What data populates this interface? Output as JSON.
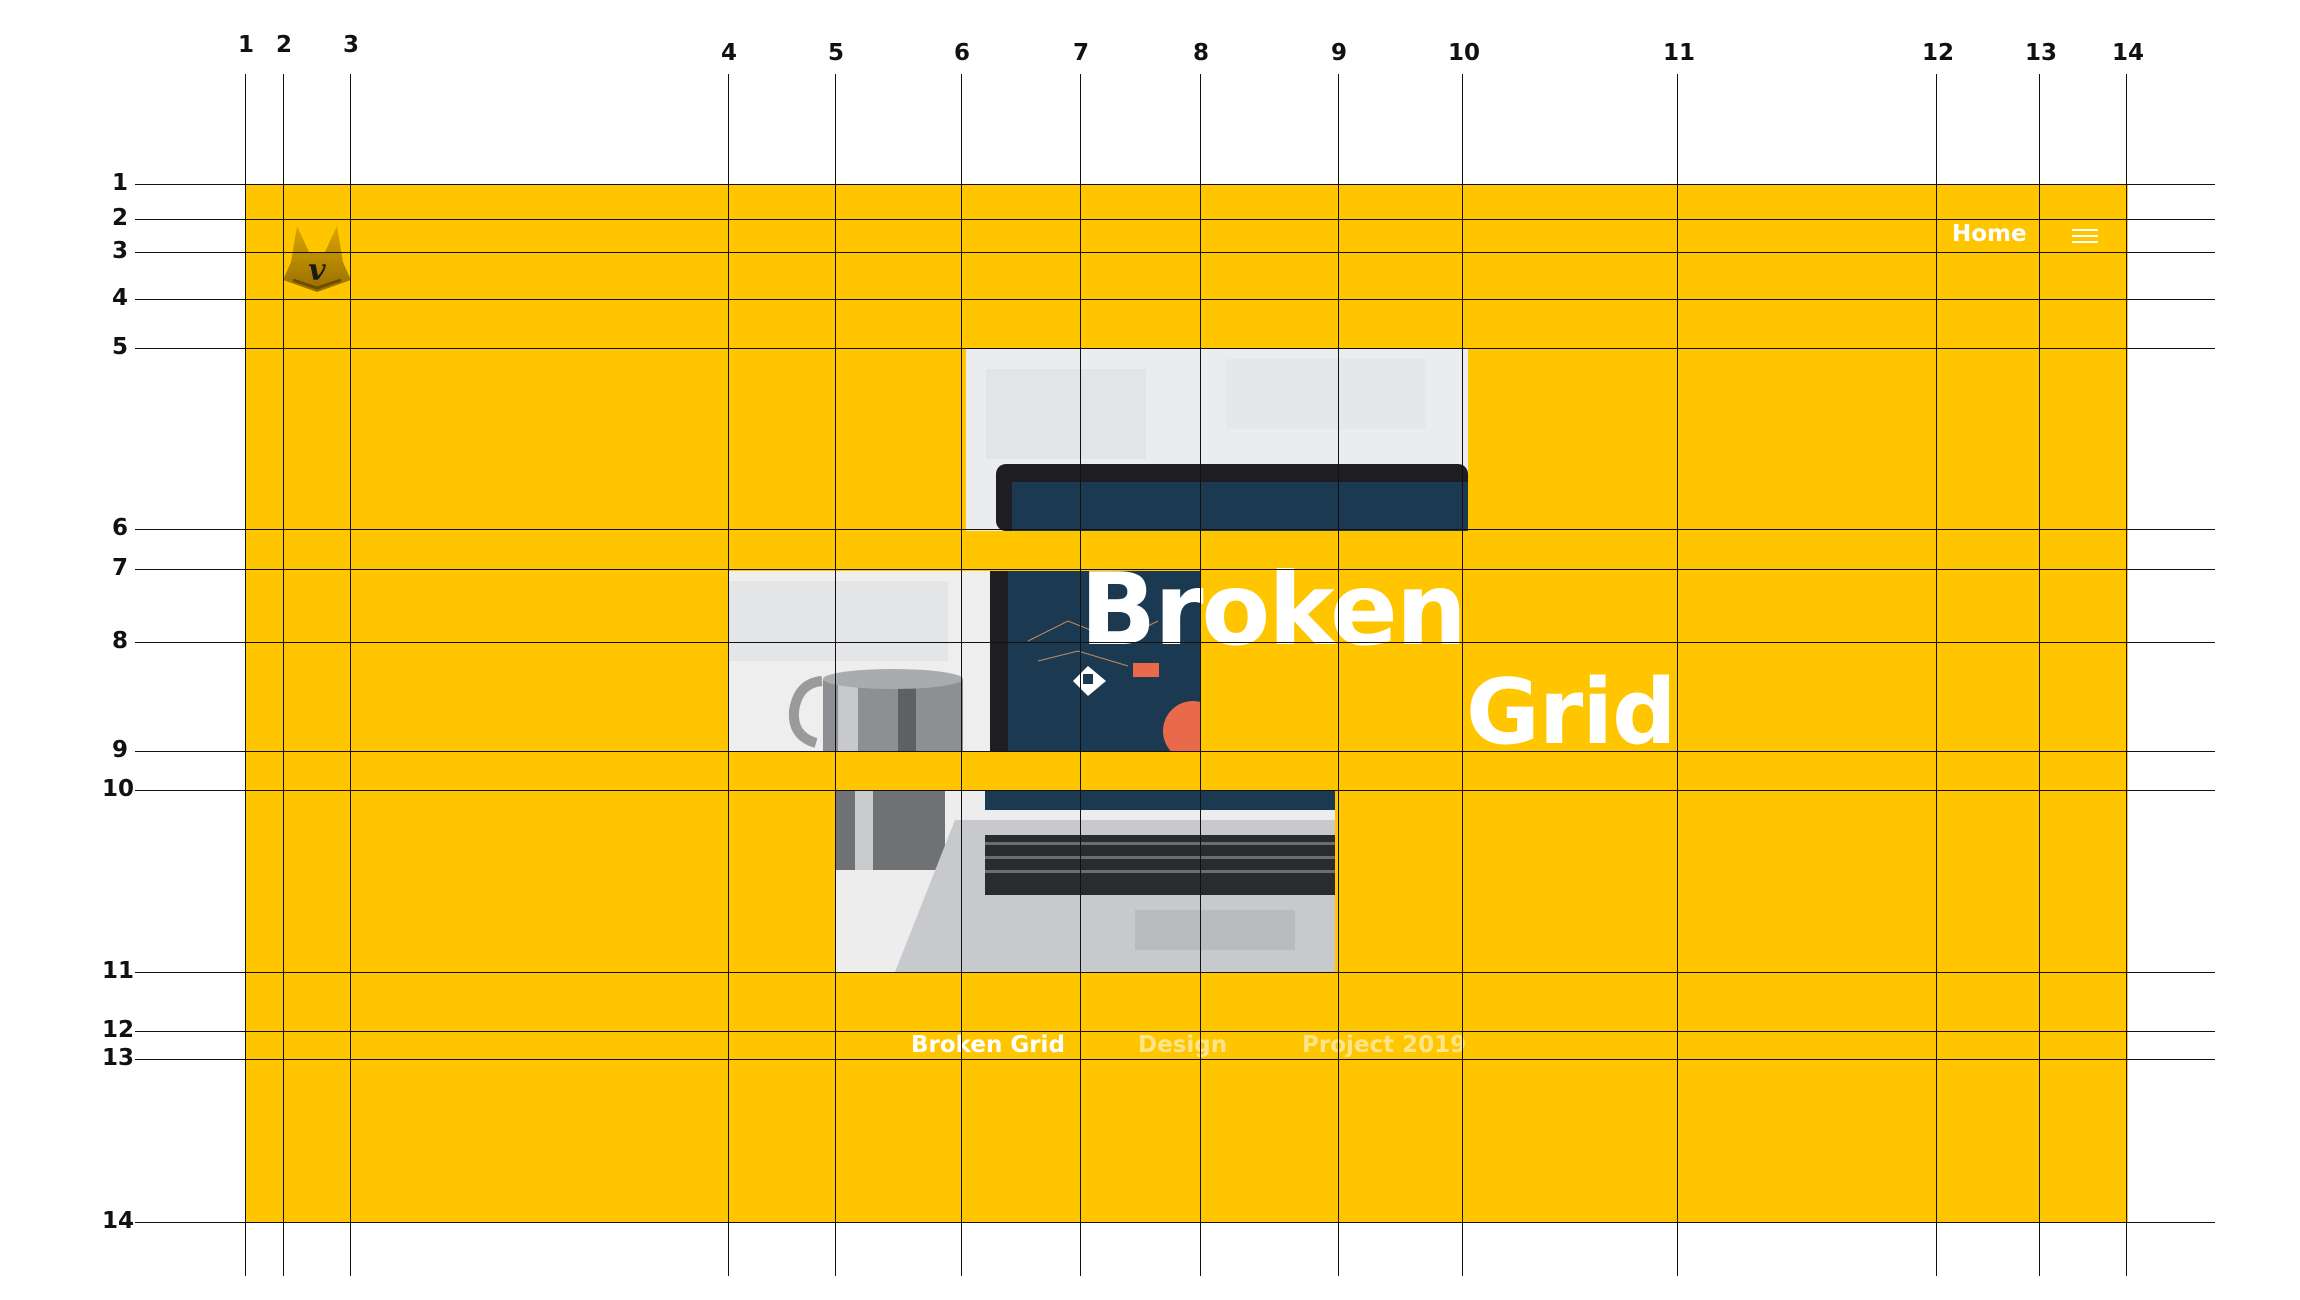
{
  "nav": {
    "home_label": "Home",
    "menu_icon": "hamburger-menu-icon"
  },
  "logo": {
    "letter": "v",
    "icon": "logo-v-icon"
  },
  "hero": {
    "title_line1": "Broken",
    "title_line2": "Grid"
  },
  "captions": [
    {
      "text": "Broken Grid",
      "color": "#ffffff"
    },
    {
      "text": "Design",
      "color": "#ffe48a"
    },
    {
      "text": "Project 2019",
      "color": "#ffe48a"
    }
  ],
  "guides": {
    "columns": [
      "1",
      "2",
      "3",
      "4",
      "5",
      "6",
      "7",
      "8",
      "9",
      "10",
      "11",
      "12",
      "13",
      "14"
    ],
    "rows": [
      "1",
      "2",
      "3",
      "4",
      "5",
      "6",
      "7",
      "8",
      "9",
      "10",
      "11",
      "12",
      "13",
      "14"
    ]
  },
  "colors": {
    "background": "#ffc600",
    "text": "#ffffff",
    "guide": "#111111"
  }
}
